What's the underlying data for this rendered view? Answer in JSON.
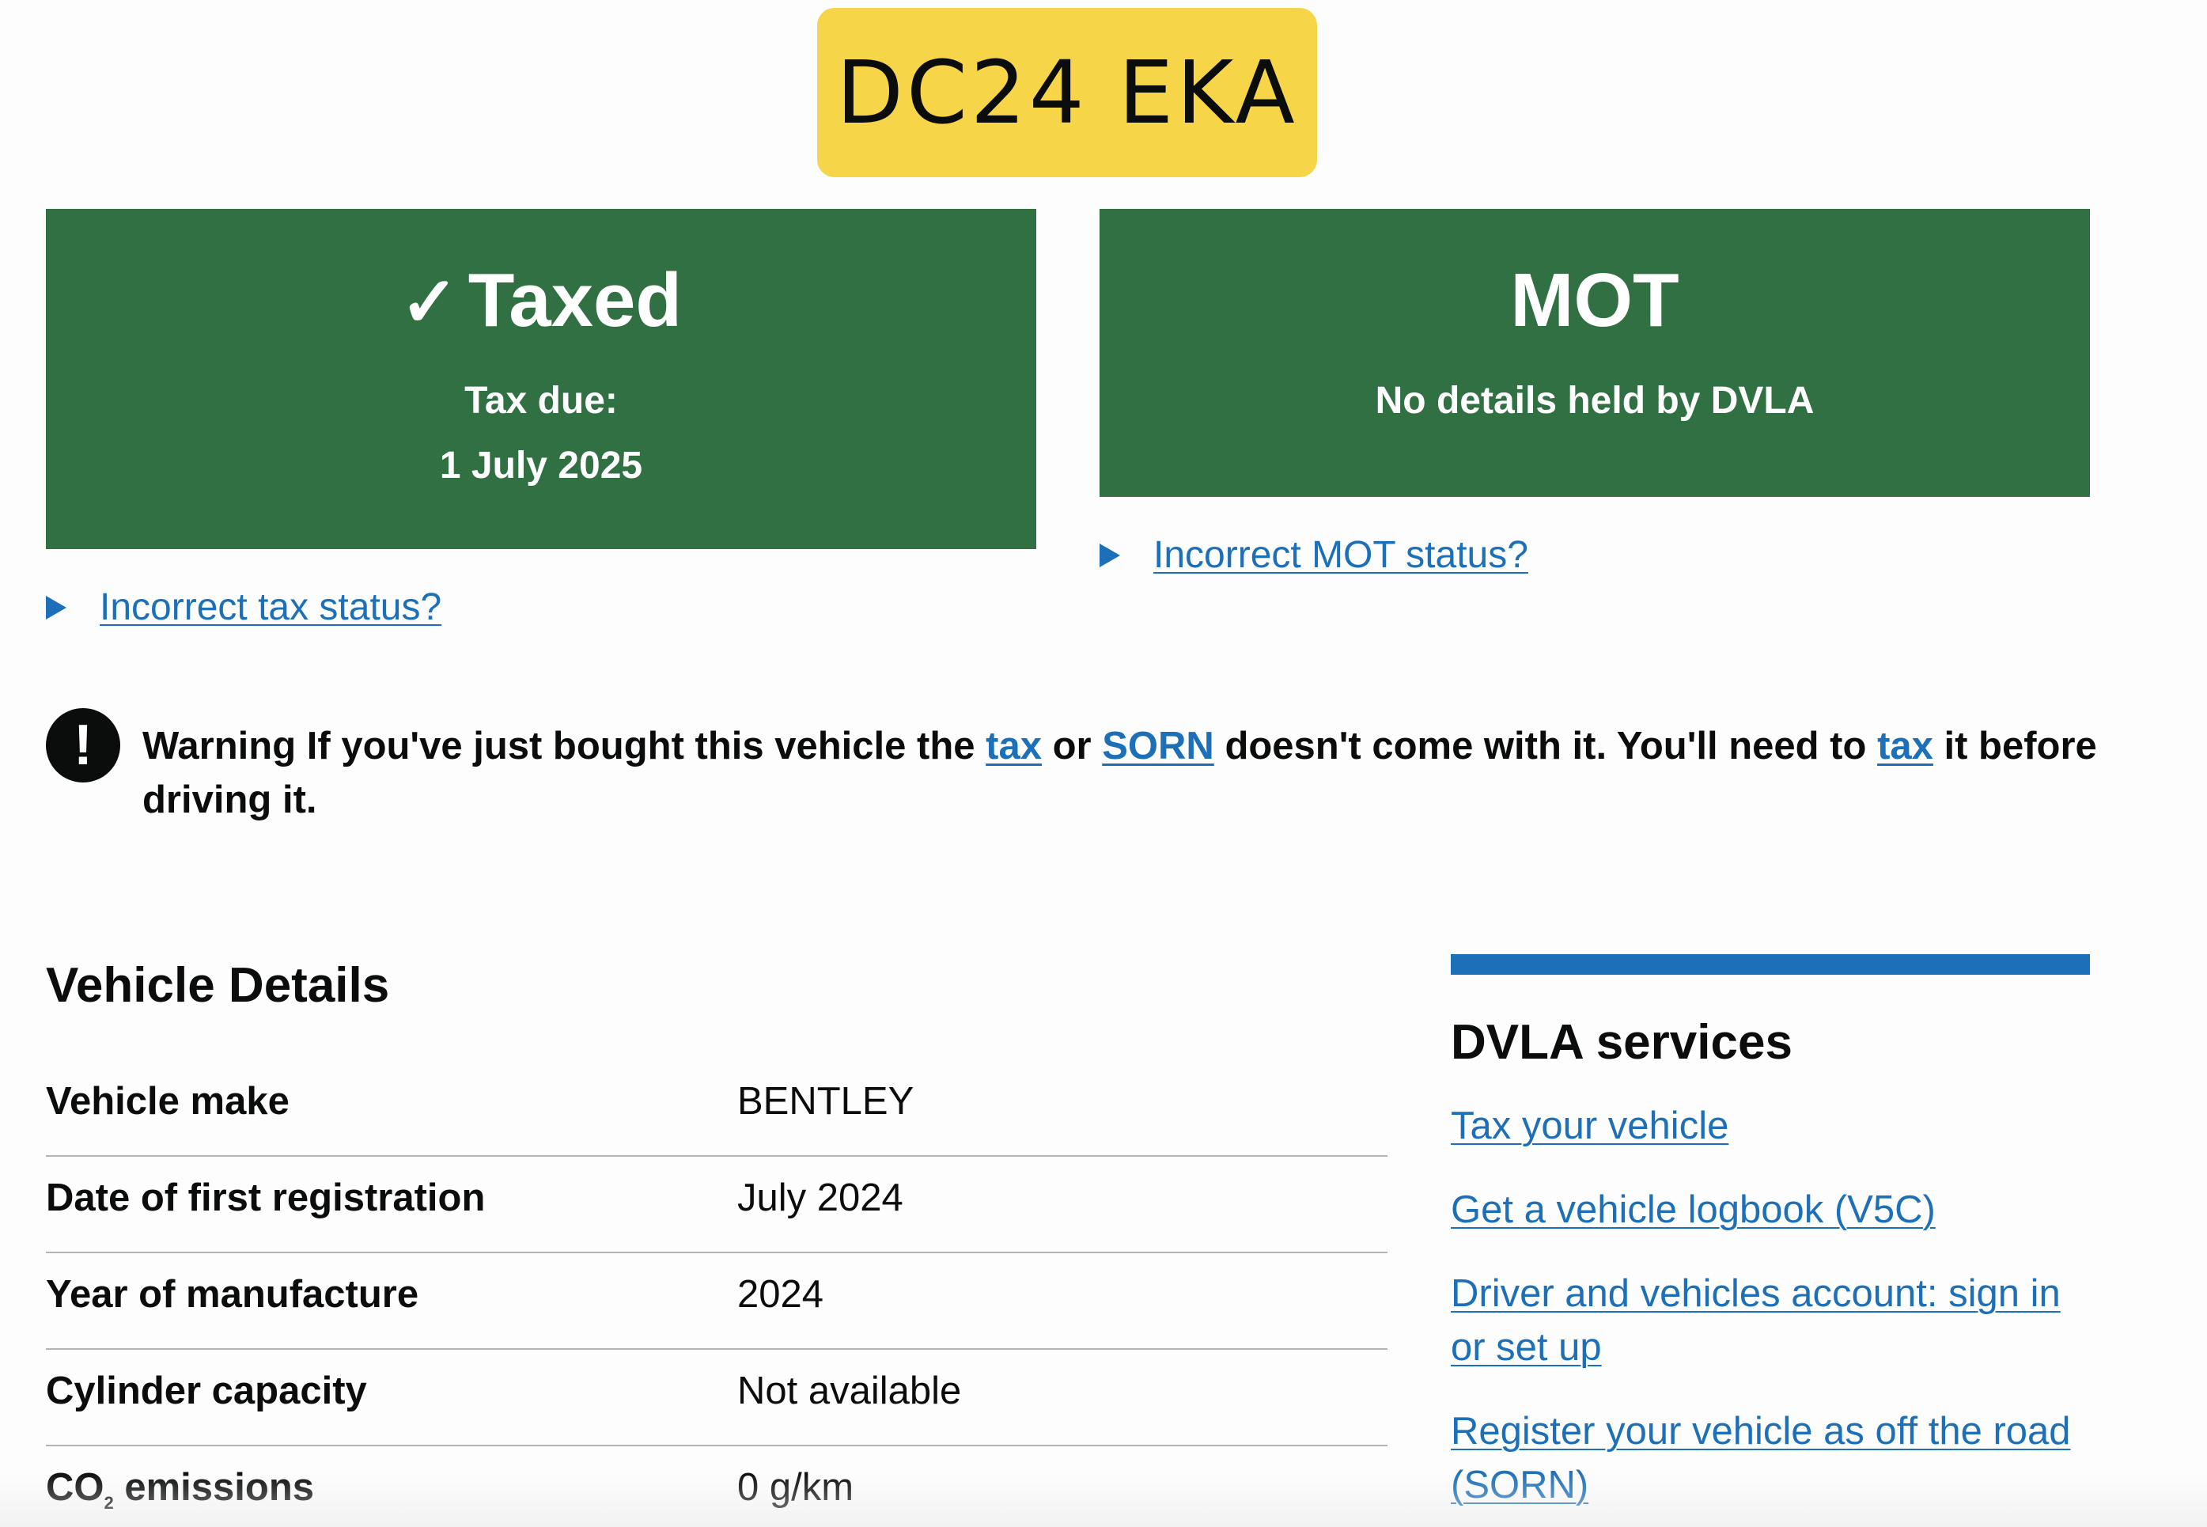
{
  "plate": {
    "registration": "DC24 EKA"
  },
  "tax": {
    "check_glyph": "✓",
    "heading": "Taxed",
    "due_label": "Tax due:",
    "due_date": "1 July 2025",
    "details_link": "Incorrect tax status?"
  },
  "mot": {
    "heading": "MOT",
    "status": "No details held by DVLA",
    "details_link": "Incorrect MOT status?"
  },
  "warning": {
    "icon": "!",
    "prefix": "Warning If you've just bought this vehicle the",
    "link_tax_1": "tax",
    "text_or": "or",
    "link_sorn": "SORN",
    "text_middle": "doesn't come with it. You'll need to",
    "link_tax_2": "tax",
    "text_end": "it before driving it."
  },
  "vehicle_details": {
    "heading": "Vehicle Details",
    "rows": [
      {
        "label": "Vehicle make",
        "value": "BENTLEY"
      },
      {
        "label": "Date of first registration",
        "value": "July 2024"
      },
      {
        "label": "Year of manufacture",
        "value": "2024"
      },
      {
        "label": "Cylinder capacity",
        "value": "Not available"
      },
      {
        "label_main": "CO",
        "label_sub": "2",
        "label_rest": " emissions",
        "value": "0 g/km"
      }
    ]
  },
  "services": {
    "heading": "DVLA services",
    "links": [
      "Tax your vehicle",
      "Get a vehicle logbook (V5C)",
      "Driver and vehicles account: sign in or set up",
      "Register your vehicle as off the road (SORN)"
    ]
  },
  "colors": {
    "plate_yellow": "#f6d548",
    "status_green": "#307043",
    "link_blue": "#1d70b8",
    "text_black": "#0b0c0c"
  }
}
